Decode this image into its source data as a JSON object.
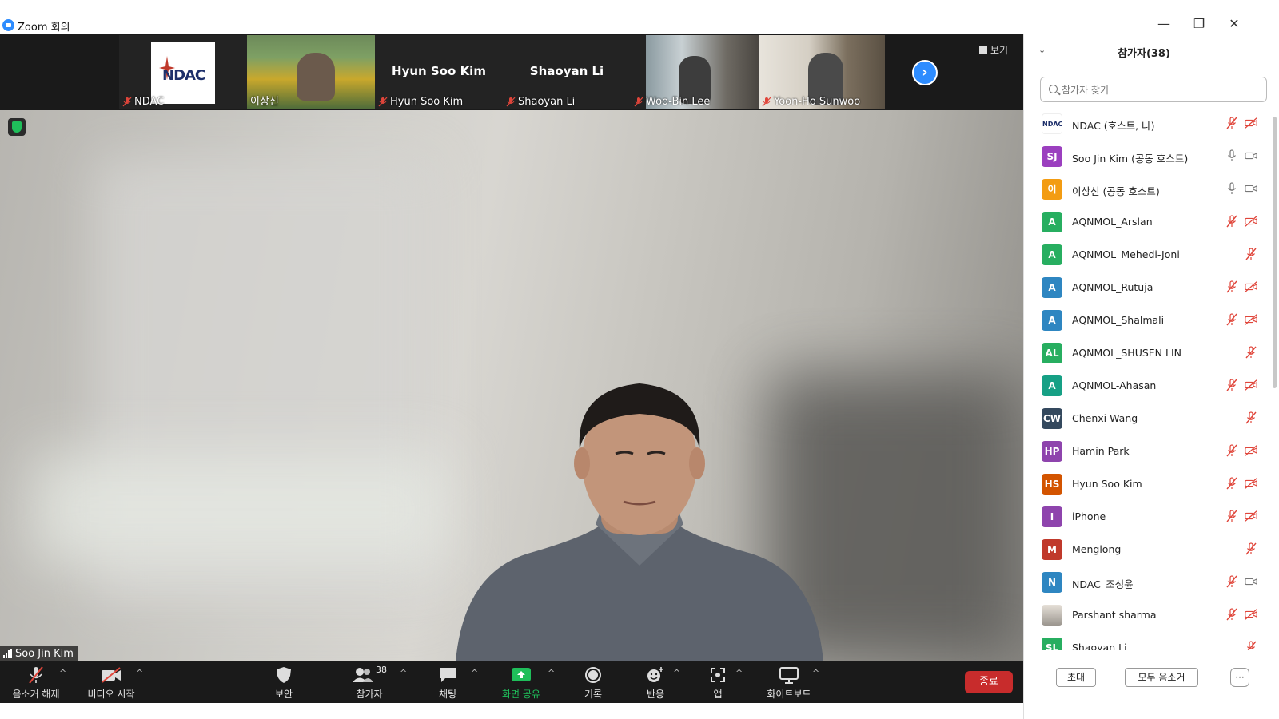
{
  "window": {
    "title": "Zoom 회의"
  },
  "strip": {
    "view_label": "보기",
    "thumbs": [
      {
        "name": "NDAC",
        "logo_text": "NDAC"
      },
      {
        "name": "이상신"
      },
      {
        "name": "Hyun Soo Kim",
        "big": "Hyun Soo Kim"
      },
      {
        "name": "Shaoyan Li",
        "big": "Shaoyan Li"
      },
      {
        "name": "Woo-Bin Lee"
      },
      {
        "name": "Yoon-Ho Sunwoo"
      }
    ]
  },
  "main": {
    "speaker": "Soo Jin Kim"
  },
  "toolbar": {
    "unmute": "음소거 해제",
    "video": "비디오 시작",
    "security": "보안",
    "participants": "참가자",
    "participants_count": "38",
    "chat": "채팅",
    "share": "화면 공유",
    "record": "기록",
    "reactions": "반응",
    "apps": "앱",
    "whiteboard": "화이트보드",
    "end": "종료"
  },
  "panel": {
    "title": "참가자(38)",
    "search_placeholder": "참가자 찾기",
    "invite": "초대",
    "mute_all": "모두 음소거",
    "more": "···",
    "participants": [
      {
        "initials": "",
        "name": "NDAC (호스트, 나)",
        "color": "#ffffff",
        "mic": "muted",
        "cam": "off"
      },
      {
        "initials": "SJ",
        "name": "Soo Jin Kim (공동 호스트)",
        "color": "#9b3fbf",
        "mic": "on",
        "cam": "on"
      },
      {
        "initials": "이",
        "name": "이상신 (공동 호스트)",
        "color": "#f39c12",
        "mic": "on",
        "cam": "on"
      },
      {
        "initials": "A",
        "name": "AQNMOL_Arslan",
        "color": "#27ae60",
        "mic": "muted",
        "cam": "off"
      },
      {
        "initials": "A",
        "name": "AQNMOL_Mehedi-Joni",
        "color": "#27ae60",
        "mic": "none",
        "cam": "muted-only"
      },
      {
        "initials": "A",
        "name": "AQNMOL_Rutuja",
        "color": "#2e86c1",
        "mic": "muted",
        "cam": "off"
      },
      {
        "initials": "A",
        "name": "AQNMOL_Shalmali",
        "color": "#2e86c1",
        "mic": "muted",
        "cam": "off"
      },
      {
        "initials": "AL",
        "name": "AQNMOL_SHUSEN LIN",
        "color": "#27ae60",
        "mic": "none",
        "cam": "muted-only"
      },
      {
        "initials": "A",
        "name": "AQNMOL-Ahasan",
        "color": "#16a085",
        "mic": "muted",
        "cam": "off"
      },
      {
        "initials": "CW",
        "name": "Chenxi Wang",
        "color": "#34495e",
        "mic": "none",
        "cam": "muted-only"
      },
      {
        "initials": "HP",
        "name": "Hamin Park",
        "color": "#8e44ad",
        "mic": "muted",
        "cam": "off"
      },
      {
        "initials": "HS",
        "name": "Hyun Soo Kim",
        "color": "#d35400",
        "mic": "muted",
        "cam": "off"
      },
      {
        "initials": "I",
        "name": "iPhone",
        "color": "#8e44ad",
        "mic": "muted",
        "cam": "off"
      },
      {
        "initials": "M",
        "name": "Menglong",
        "color": "#c0392b",
        "mic": "none",
        "cam": "muted-only"
      },
      {
        "initials": "N",
        "name": "NDAC_조성윤",
        "color": "#2e86c1",
        "mic": "muted",
        "cam": "on"
      },
      {
        "initials": "",
        "name": "Parshant sharma",
        "color": "#bbbbbb",
        "mic": "muted",
        "cam": "off"
      },
      {
        "initials": "SL",
        "name": "Shaoyan Li",
        "color": "#27ae60",
        "mic": "none",
        "cam": "muted-only"
      }
    ]
  },
  "colors": {
    "accent": "#2d8cff",
    "mute_red": "#e0453a",
    "share_green": "#1fbe5a",
    "end_red": "#c82c2c"
  }
}
